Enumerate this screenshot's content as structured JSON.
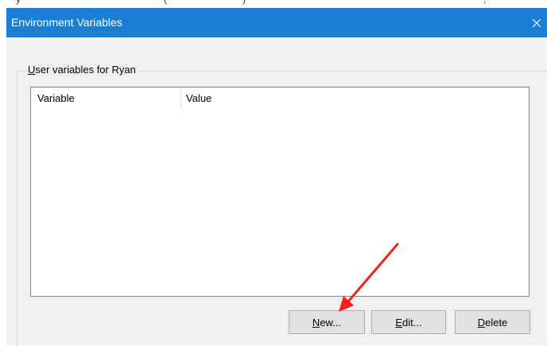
{
  "dialog": {
    "title": "Environment Variables",
    "close_glyph": "✕"
  },
  "user_group": {
    "label_mnemonic": "U",
    "label_rest": "ser variables for Ryan"
  },
  "list": {
    "columns": [
      "Variable",
      "Value"
    ],
    "rows": []
  },
  "buttons": {
    "new": {
      "mnemonic": "N",
      "rest": "ew..."
    },
    "edit": {
      "mnemonic": "E",
      "rest": "dit..."
    },
    "delete": {
      "mnemonic": "D",
      "rest": "elete"
    }
  },
  "colors": {
    "titlebar": "#1a7fd3",
    "annotation_arrow": "#f2231b"
  },
  "icons": {
    "close": "close-icon",
    "annotation": "red-arrow-annotation"
  }
}
